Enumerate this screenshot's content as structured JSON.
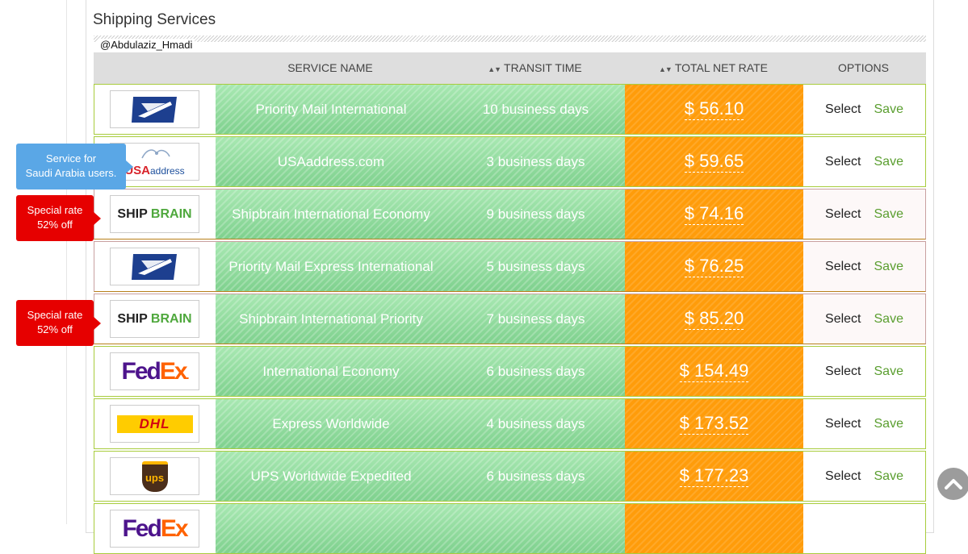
{
  "panel": {
    "title": "Shipping Services",
    "watermark": "@Abdulaziz_Hmadi"
  },
  "table": {
    "headers": {
      "service_name": "SERVICE NAME",
      "transit_time": "TRANSIT TIME",
      "total_net_rate": "TOTAL NET RATE",
      "options": "OPTIONS"
    },
    "rows": [
      {
        "carrier": "usps-logo",
        "service": "Priority Mail International",
        "transit": "10 business days",
        "rate": "$ 56.10",
        "select": "Select",
        "save": "Save"
      },
      {
        "carrier": "usaaddress-logo",
        "service": "USAaddress.com",
        "transit": "3 business days",
        "rate": "$ 59.65",
        "select": "Select",
        "save": "Save"
      },
      {
        "carrier": "shipbrain-logo",
        "service": "Shipbrain International Economy",
        "transit": "9 business days",
        "rate": "$ 74.16",
        "select": "Select",
        "save": "Save"
      },
      {
        "carrier": "usps-logo",
        "service": "Priority Mail Express International",
        "transit": "5 business days",
        "rate": "$ 76.25",
        "select": "Select",
        "save": "Save"
      },
      {
        "carrier": "shipbrain-logo",
        "service": "Shipbrain International Priority",
        "transit": "7 business days",
        "rate": "$ 85.20",
        "select": "Select",
        "save": "Save"
      },
      {
        "carrier": "fedex-logo",
        "service": "International Economy",
        "transit": "6 business days",
        "rate": "$ 154.49",
        "select": "Select",
        "save": "Save"
      },
      {
        "carrier": "dhl-logo",
        "service": "Express Worldwide",
        "transit": "4 business days",
        "rate": "$ 173.52",
        "select": "Select",
        "save": "Save"
      },
      {
        "carrier": "ups-logo",
        "service": "UPS Worldwide Expedited",
        "transit": "6 business days",
        "rate": "$ 177.23",
        "select": "Select",
        "save": "Save"
      },
      {
        "carrier": "fedex-logo",
        "service": "",
        "transit": "",
        "rate": "",
        "select": "",
        "save": ""
      }
    ]
  },
  "tooltips": {
    "usaaddress": {
      "line1": "Service for",
      "line2": "Saudi Arabia users."
    },
    "special1": {
      "line1": "Special rate",
      "line2": "52% off"
    },
    "special2": {
      "line1": "Special rate",
      "line2": "52% off"
    }
  },
  "logos": {
    "shipbrain_ship": "SHIP",
    "shipbrain_brain": "BRAIN",
    "fedex_fed": "Fed",
    "fedex_ex": "Ex",
    "usa_address_usa": "USA",
    "usa_address_rest": "address",
    "dhl": "DHL",
    "ups": "ups"
  },
  "colors": {
    "service_green": "#7fd18e",
    "rate_orange": "#ff9c0a",
    "save_green": "#5a9e2f",
    "row_border": "#a8cc3d",
    "special_red": "#e60000",
    "tooltip_blue": "#5aa7e6",
    "usps_blue": "#1d3f8f",
    "fedex_purple": "#4d148c",
    "fedex_orange": "#ff6200",
    "dhl_yellow": "#ffcc00",
    "dhl_red": "#d40511",
    "ups_brown": "#4b2e1a",
    "shipbrain_green": "#4fa83d"
  },
  "icons": {
    "scroll_top": "chevron-up-icon",
    "sort": "sort-arrows-icon"
  }
}
